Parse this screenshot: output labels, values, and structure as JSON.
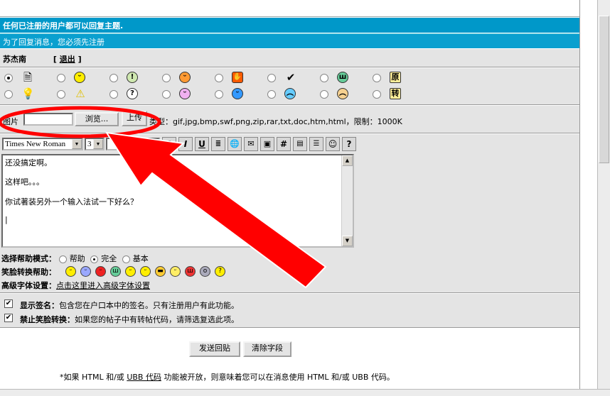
{
  "header": {
    "notice": "任何已注册的用户都可以回复主题.",
    "register_notice": "为了回复消息，您必须先注册"
  },
  "user": {
    "name": "苏杰南",
    "logout_open": "[",
    "logout_label": "退出",
    "logout_close": "]"
  },
  "upload": {
    "label": "图片",
    "browse_label": "浏览...",
    "upload_label": "上传",
    "types_text": "类型：gif,jpg,bmp,swf,png,zip,rar,txt,doc,htm,html，限制：1000K"
  },
  "editor": {
    "font_value": "Times New Roman",
    "size_value": "3",
    "lines": [
      "还没搞定啊。",
      "这样吧。。。",
      "你试著装另外一个输入法试一下好么？",
      "|"
    ]
  },
  "help": {
    "mode_label": "选择帮助模式：",
    "mode_options": [
      "帮助",
      "完全",
      "基本"
    ],
    "smiley_label": "笑脸转换帮助：",
    "font_label": "高级字体设置：",
    "font_link": "点击这里进入高级字体设置"
  },
  "options": {
    "signature_title": "显示签名：",
    "signature_desc": "包含您在户口本中的签名。只有注册用户有此功能。",
    "smiley_title": "禁止笑脸转换：",
    "smiley_desc": "如果您的帖子中有转帖代码，请筛选复选此项。"
  },
  "buttons": {
    "submit": "发送回贴",
    "clear": "清除字段"
  },
  "footnote": {
    "prefix": "*如果 HTML 和/或 ",
    "link": "UBB 代码",
    "suffix": " 功能被开放，则意味着您可以在消息使用 HTML 和/或 UBB 代码。"
  },
  "icon_grid_labels": {
    "yuan": "原",
    "zhuan": "转"
  },
  "colors": {
    "header_blue": "#0098c9",
    "panel_gray": "#e4e4e4",
    "annotation_red": "#ff0000"
  }
}
